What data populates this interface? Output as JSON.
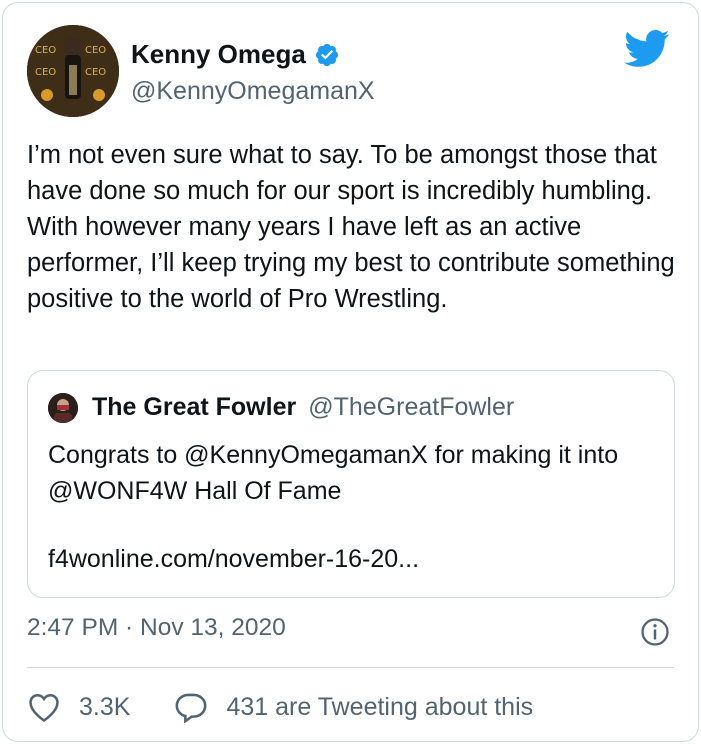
{
  "author": {
    "name": "Kenny Omega",
    "handle": "@KennyOmegamanX",
    "verified": true,
    "avatar_text": [
      "CEO",
      "CEO",
      "CEO",
      "CEO"
    ]
  },
  "tweet": {
    "text": "I’m not even sure what to say. To be amongst those that have done so much for our sport is incredibly humbling. With however many years I have left as an active performer, I’ll keep trying my best to contribute something positive to the world of Pro Wrestling.",
    "timestamp": "2:47 PM · Nov 13, 2020"
  },
  "quoted": {
    "name": "The Great Fowler",
    "handle": "@TheGreatFowler",
    "text": "Congrats to @KennyOmegamanX for making it into @WONF4W Hall Of Fame",
    "link": "f4wonline.com/november-16-20..."
  },
  "actions": {
    "likes": "3.3K",
    "tweeting": "431 are Tweeting about this"
  },
  "colors": {
    "twitter_blue": "#1d9bf0",
    "secondary_text": "#536471",
    "border": "#cfd9de"
  },
  "icons": [
    "twitter-bird-icon",
    "verified-badge-icon",
    "info-icon",
    "heart-icon",
    "reply-bubble-icon"
  ]
}
